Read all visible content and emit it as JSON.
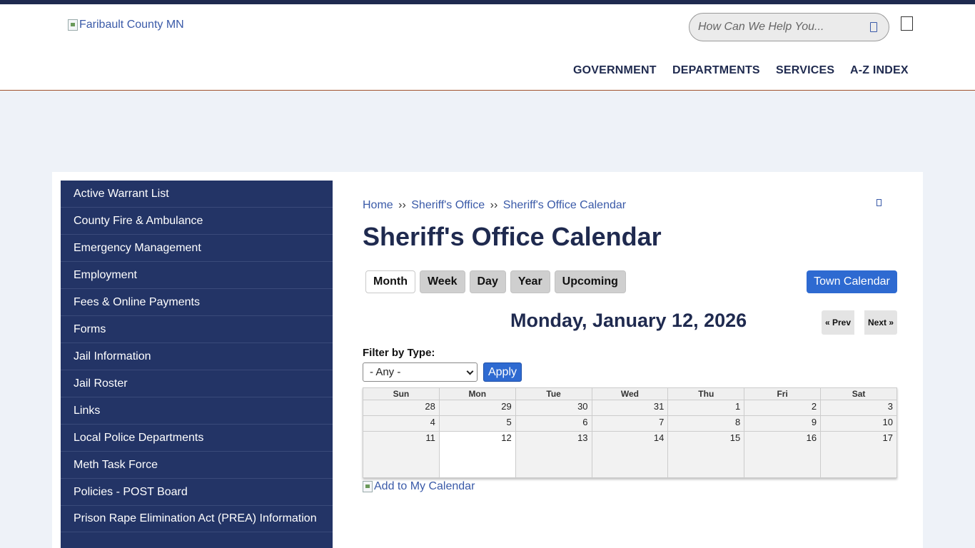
{
  "header": {
    "logo_alt": "Faribault County MN",
    "search_placeholder": "How Can We Help You...",
    "nav": [
      "GOVERNMENT",
      "DEPARTMENTS",
      "SERVICES",
      "A-Z INDEX"
    ]
  },
  "sidebar": {
    "items": [
      "Active Warrant List",
      "County Fire & Ambulance",
      "Emergency Management",
      "Employment",
      "Fees & Online Payments",
      "Forms",
      "Jail Information",
      "Jail Roster",
      "Links",
      "Local Police Departments",
      "Meth Task Force",
      "Policies - POST Board",
      "Prison Rape Elimination Act (PREA) Information"
    ]
  },
  "breadcrumb": {
    "items": [
      "Home",
      "Sheriff's Office",
      "Sheriff's Office Calendar"
    ],
    "separator": "››"
  },
  "page_title": "Sheriff's Office Calendar",
  "calendar_views": {
    "tabs": [
      "Month",
      "Week",
      "Day",
      "Year",
      "Upcoming"
    ],
    "active": "Month",
    "town_calendar": "Town Calendar"
  },
  "date_heading": "Monday, January 12, 2026",
  "pager": {
    "prev": "« Prev",
    "next": "Next »"
  },
  "filter": {
    "label": "Filter by Type:",
    "selected": "- Any -",
    "apply": "Apply"
  },
  "calendar": {
    "days": [
      "Sun",
      "Mon",
      "Tue",
      "Wed",
      "Thu",
      "Fri",
      "Sat"
    ],
    "weeks": [
      [
        "28",
        "29",
        "30",
        "31",
        "1",
        "2",
        "3"
      ],
      [
        "4",
        "5",
        "6",
        "7",
        "8",
        "9",
        "10"
      ],
      [
        "11",
        "12",
        "13",
        "14",
        "15",
        "16",
        "17"
      ]
    ],
    "today": "12"
  },
  "add_to_calendar_alt": "Add to My Calendar",
  "colors": {
    "navy": "#1f2a4f",
    "sidebar": "#233466",
    "link": "#3a5aa8",
    "button_blue": "#2e6ad1",
    "page_bg": "#eef2f8"
  }
}
